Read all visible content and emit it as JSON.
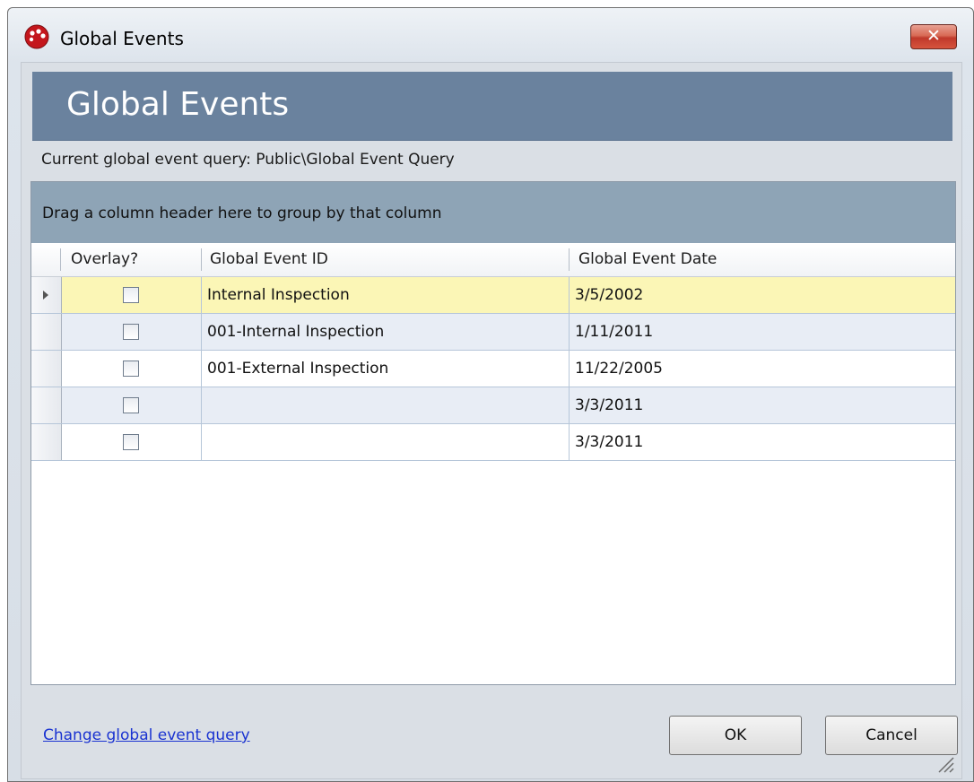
{
  "window": {
    "title": "Global Events",
    "close_label": "✕",
    "icon": "app-logo-icon"
  },
  "header": {
    "title": "Global Events"
  },
  "query_label": "Current global event query: Public\\Global Event Query",
  "grid": {
    "group_panel_text": "Drag a column header here to group by that column",
    "columns": [
      "Overlay?",
      "Global Event ID",
      "Global Event Date"
    ],
    "rows": [
      {
        "overlay": false,
        "id": "Internal Inspection",
        "date": "3/5/2002"
      },
      {
        "overlay": false,
        "id": "001-Internal Inspection",
        "date": "1/11/2011"
      },
      {
        "overlay": false,
        "id": "001-External Inspection",
        "date": "11/22/2005"
      },
      {
        "overlay": false,
        "id": "",
        "date": "3/3/2011"
      },
      {
        "overlay": false,
        "id": "",
        "date": "3/3/2011"
      }
    ]
  },
  "footer": {
    "link_text": "Change global event query",
    "ok_label": "OK",
    "cancel_label": "Cancel"
  },
  "colors": {
    "header_banner": "#6a829e",
    "group_panel": "#8ea4b6",
    "selected_row": "#fbf6b6",
    "alt_row": "#e8edf5",
    "link": "#1a33d1",
    "close_button": "#c0392b"
  }
}
